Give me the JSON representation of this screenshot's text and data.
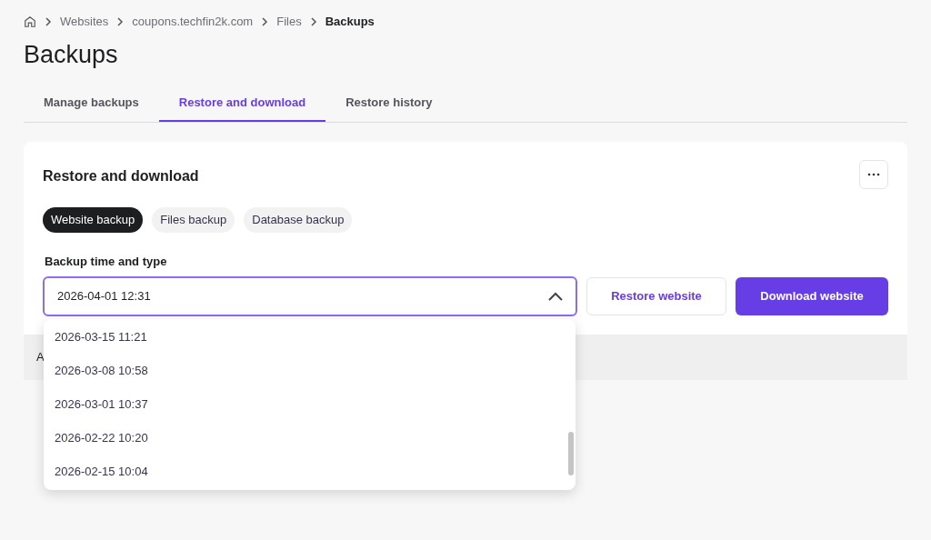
{
  "breadcrumb": [
    {
      "label": "Websites",
      "current": false
    },
    {
      "label": "coupons.techfin2k.com",
      "current": false
    },
    {
      "label": "Files",
      "current": false
    },
    {
      "label": "Backups",
      "current": true
    }
  ],
  "title": "Backups",
  "tabs": [
    {
      "label": "Manage backups",
      "selected": false
    },
    {
      "label": "Restore and download",
      "selected": true
    },
    {
      "label": "Restore history",
      "selected": false
    }
  ],
  "card": {
    "title": "Restore and download",
    "filters": [
      {
        "label": "Website backup",
        "selected": true
      },
      {
        "label": "Files backup",
        "selected": false
      },
      {
        "label": "Database backup",
        "selected": false
      }
    ],
    "field_label": "Backup time and type",
    "select": {
      "value": "2026-04-01 12:31",
      "expanded": true,
      "options": [
        "2026-03-15 11:21",
        "2026-03-08 10:58",
        "2026-03-01 10:37",
        "2026-02-22 10:20",
        "2026-02-15 10:04"
      ]
    },
    "buttons": [
      {
        "label": "Restore website",
        "kind": "secondary"
      },
      {
        "label": "Download website",
        "kind": "primary"
      }
    ]
  },
  "notice": "A"
}
